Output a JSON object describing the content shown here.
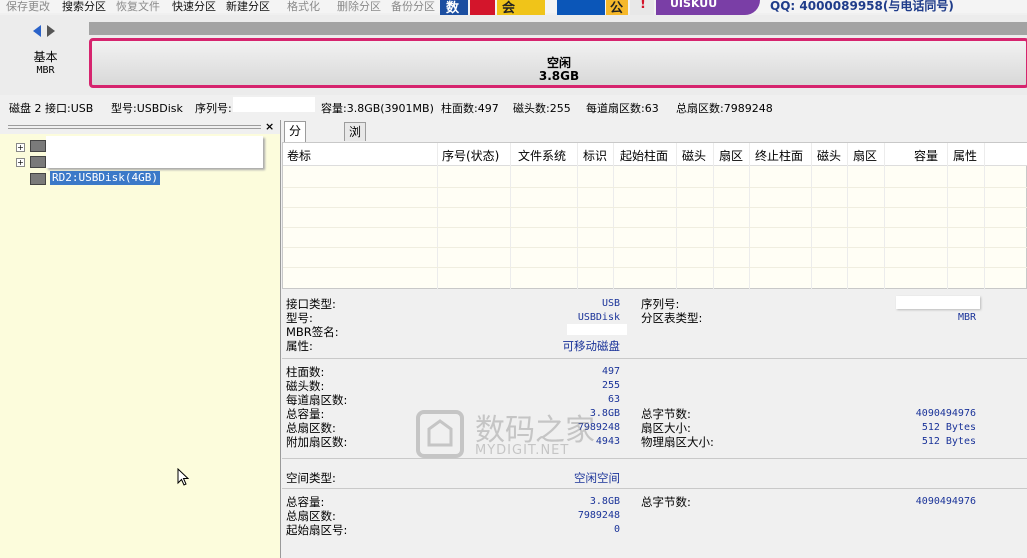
{
  "toolbar": {
    "items": [
      {
        "label": "保存更改",
        "enabled": false
      },
      {
        "label": "搜索分区",
        "enabled": true
      },
      {
        "label": "恢复文件",
        "enabled": false
      },
      {
        "label": "快速分区",
        "enabled": true
      },
      {
        "label": "新建分区",
        "enabled": true
      },
      {
        "label": "格式化",
        "enabled": false
      },
      {
        "label": "删除分区",
        "enabled": false
      },
      {
        "label": "备份分区",
        "enabled": false
      }
    ]
  },
  "ad": {
    "glyph1": "数",
    "glyph2": "会",
    "glyph3": "公",
    "brand_fragment": "UISKUU",
    "qq": "QQ: 4000089958(与电话同号)"
  },
  "diskmap": {
    "disk_type": "基本",
    "partition_style": "MBR",
    "partition_name": "空闲",
    "partition_size": "3.8GB"
  },
  "diskinfo": {
    "disk_iface": "磁盘 2 接口:USB",
    "model": "型号:USBDisk",
    "serial_label": "序列号:",
    "capacity": "容量:3.8GB(3901MB)",
    "cylinders": "柱面数:497",
    "heads": "磁头数:255",
    "sectors_per_track": "每道扇区数:63",
    "total_sectors": "总扇区数:7989248"
  },
  "tree": {
    "selected_label": "RD2:USBDisk(4GB)"
  },
  "tabs": [
    {
      "label": "分区参数",
      "active": true
    },
    {
      "label": "浏览文件",
      "active": false
    }
  ],
  "table": {
    "columns": [
      "卷标",
      "序号(状态)",
      "文件系统",
      "标识",
      "起始柱面",
      "磁头",
      "扇区",
      "终止柱面",
      "磁头",
      "扇区",
      "容量",
      "属性"
    ]
  },
  "details": {
    "iface_type_label": "接口类型:",
    "iface_type_value": "USB",
    "model_label": "型号:",
    "model_value": "USBDisk",
    "mbr_sig_label": "MBR签名:",
    "attr_label": "属性:",
    "attr_value": "可移动磁盘",
    "serial_label": "序列号:",
    "ptable_label": "分区表类型:",
    "ptable_value": "MBR",
    "cyl_label": "柱面数:",
    "cyl_value": "497",
    "heads_label": "磁头数:",
    "heads_value": "255",
    "spt_label": "每道扇区数:",
    "spt_value": "63",
    "total_cap_label": "总容量:",
    "total_cap_value": "3.8GB",
    "total_sec_label": "总扇区数:",
    "total_sec_value": "7989248",
    "extra_sec_label": "附加扇区数:",
    "extra_sec_value": "4943",
    "total_bytes_label": "总字节数:",
    "total_bytes_value": "4090494976",
    "sec_size_label": "扇区大小:",
    "sec_size_value": "512 Bytes",
    "phys_sec_label": "物理扇区大小:",
    "phys_sec_value": "512 Bytes",
    "space_type_label": "空间类型:",
    "space_type_value": "空闲空间",
    "total_cap2_label": "总容量:",
    "total_cap2_value": "3.8GB",
    "total_bytes2_label": "总字节数:",
    "total_bytes2_value": "4090494976",
    "total_sec2_label": "总扇区数:",
    "total_sec2_value": "7989248",
    "start_sec_label": "起始扇区号:",
    "start_sec_value": "0"
  },
  "watermark": {
    "cn": "数码之家",
    "en": "MYDIGIT.NET"
  }
}
